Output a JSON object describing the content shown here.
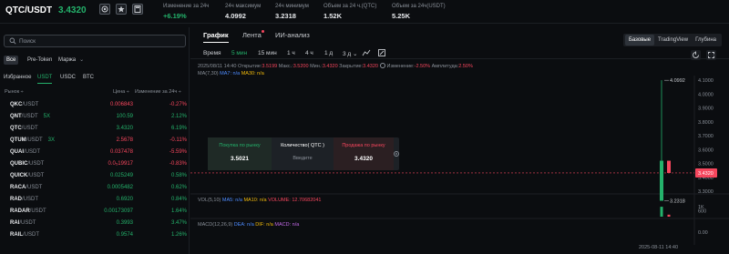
{
  "header": {
    "pair": "QTC/USDT",
    "price": "3.4320",
    "stats": [
      {
        "label": "Изменение за 24ч",
        "value": "+6.19%",
        "up": true
      },
      {
        "label": "24ч максимум",
        "value": "4.0992"
      },
      {
        "label": "24ч минимум",
        "value": "3.2318"
      },
      {
        "label": "Объем за 24 ч.(QTC)",
        "value": "1.52K"
      },
      {
        "label": "Объем за 24ч(USDT)",
        "value": "5.25K"
      }
    ],
    "icons": [
      "coin-icon",
      "star-icon",
      "calculator-icon"
    ]
  },
  "market": {
    "search_placeholder": "Поиск",
    "filters": [
      "Все",
      "Pre-Token",
      "Маржа"
    ],
    "tabs": [
      "Избранное",
      "USDT",
      "USDC",
      "BTC"
    ],
    "columns": {
      "pair": "Рынок ÷",
      "price": "Цена ÷",
      "change": "Изменение за 24ч ÷"
    },
    "rows": [
      {
        "base": "QKC",
        "quote": "/USDT",
        "lev": "",
        "price": "0.006843",
        "change": "-0.27%",
        "dir": "neg"
      },
      {
        "base": "QNT",
        "quote": "/USDT",
        "lev": "5X",
        "price": "100.59",
        "change": "2.12%",
        "dir": "pos"
      },
      {
        "base": "QTC",
        "quote": "/USDT",
        "lev": "",
        "price": "3.4320",
        "change": "6.19%",
        "dir": "pos"
      },
      {
        "base": "QTUM",
        "quote": "/USDT",
        "lev": "3X",
        "price": "2.5678",
        "change": "-0.11%",
        "dir": "neg"
      },
      {
        "base": "QUAI",
        "quote": "/USDT",
        "lev": "",
        "price": "0.037478",
        "change": "-5.59%",
        "dir": "neg"
      },
      {
        "base": "QUBIC",
        "quote": "/USDT",
        "lev": "",
        "price": "0.0₅19917",
        "change": "-0.83%",
        "dir": "neg"
      },
      {
        "base": "QUICK",
        "quote": "/USDT",
        "lev": "",
        "price": "0.025249",
        "change": "0.58%",
        "dir": "pos"
      },
      {
        "base": "RACA",
        "quote": "/USDT",
        "lev": "",
        "price": "0.0005482",
        "change": "0.62%",
        "dir": "pos"
      },
      {
        "base": "RAD",
        "quote": "/USDT",
        "lev": "",
        "price": "0.6920",
        "change": "0.84%",
        "dir": "pos"
      },
      {
        "base": "RADAR",
        "quote": "/USDT",
        "lev": "",
        "price": "0.00173097",
        "change": "1.64%",
        "dir": "pos"
      },
      {
        "base": "RAI",
        "quote": "/USDT",
        "lev": "",
        "price": "0.3993",
        "change": "3.47%",
        "dir": "pos"
      },
      {
        "base": "RAIL",
        "quote": "/USDT",
        "lev": "",
        "price": "0.9574",
        "change": "1.26%",
        "dir": "pos"
      }
    ]
  },
  "chart_tabs": {
    "tabs": [
      "График",
      "Лента",
      "ИИ-анализ"
    ],
    "views": [
      "Базовые",
      "TradingView",
      "Глубина"
    ]
  },
  "intervals": [
    "Время",
    "5 мин",
    "15 мин",
    "1 ч",
    "4 ч",
    "1 д",
    "3 д"
  ],
  "interval_active": "5 мин",
  "ohlc": {
    "time": "2025/08/11 14:40",
    "open_label": "Открытие:",
    "open": "3.5199",
    "high_label": "Макс.:",
    "high": "3.5200",
    "low_label": "Мин.:",
    "low": "3.4320",
    "close_label": "Закрытие:",
    "close": "3.4320",
    "change_label": "Изменение:",
    "change": "-2.50%",
    "amp_label": "Амплитуда:",
    "amp": "2.50%"
  },
  "indicators": {
    "ma": {
      "name": "MA(7,30)",
      "ma7": "MA7: n/a",
      "ma30": "MA30: n/a"
    },
    "vol": {
      "name": "VOL(5,10)",
      "ma5": "MA5: n/a",
      "ma10": "MA10: n/a",
      "volume": "VOLUME: 12.70682041"
    },
    "macd": {
      "name": "MACD(12,26,9)",
      "dea": "DEA: n/a",
      "dif": "DIF: n/a",
      "macd": "MACD: n/a"
    }
  },
  "trade_widget": {
    "buy_label": "Покупка по рынку",
    "buy_price": "3.5021",
    "qty_label": "Количество( QTC )",
    "qty_placeholder": "Введите",
    "sell_label": "Продажа по рынку",
    "sell_price": "3.4320"
  },
  "time_label": "2025-08-11 14:40",
  "colors": {
    "up": "#24b26b",
    "down": "#f6465d",
    "bg": "#0b0d10"
  },
  "chart_data": {
    "type": "candlestick",
    "price_axis": {
      "ticks": [
        "4.1000",
        "4.0000",
        "3.9000",
        "3.8000",
        "3.7000",
        "3.6000",
        "3.5000",
        "3.4000",
        "3.3000",
        "3.2000"
      ],
      "min": 3.15,
      "max": 4.12,
      "last_price": "3.4320",
      "high_marker": "4.0992",
      "low_marker": "3.2318"
    },
    "candles": [
      {
        "o": 3.2318,
        "h": 4.0992,
        "l": 3.2318,
        "c": 3.5199,
        "dir": "up"
      },
      {
        "o": 3.5199,
        "h": 3.52,
        "l": 3.432,
        "c": 3.432,
        "dir": "down"
      }
    ],
    "volume_axis": {
      "ticks": [
        "1K",
        "600"
      ],
      "min": 0,
      "max": 1100
    },
    "volumes": [
      {
        "v": 1000,
        "dir": "up"
      },
      {
        "v": 200,
        "dir": "down"
      }
    ],
    "macd_axis": {
      "ticks": [
        "0.00"
      ]
    }
  }
}
